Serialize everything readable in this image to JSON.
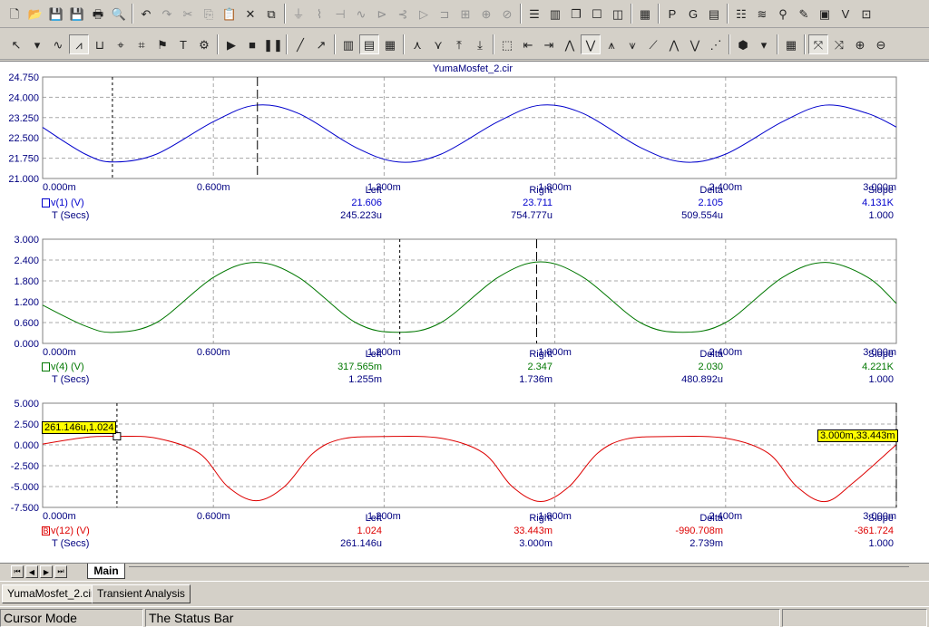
{
  "toolbar1": {
    "buttons": [
      {
        "name": "new-file-icon",
        "glyph": "🗋",
        "dim": false
      },
      {
        "name": "open-file-icon",
        "glyph": "📂",
        "dim": false
      },
      {
        "name": "save-icon",
        "glyph": "💾",
        "dim": false
      },
      {
        "name": "save-all-icon",
        "glyph": "💾",
        "dim": false
      },
      {
        "name": "print-icon",
        "glyph": "🖶",
        "dim": false
      },
      {
        "name": "print-preview-icon",
        "glyph": "🔍",
        "dim": false
      },
      {
        "name": "undo-icon",
        "glyph": "↶",
        "dim": false
      },
      {
        "name": "redo-icon",
        "glyph": "↷",
        "dim": true
      },
      {
        "name": "cut-icon",
        "glyph": "✂",
        "dim": true
      },
      {
        "name": "copy-icon",
        "glyph": "⎘",
        "dim": true
      },
      {
        "name": "paste-icon",
        "glyph": "📋",
        "dim": false
      },
      {
        "name": "delete-icon",
        "glyph": "✕",
        "dim": false
      },
      {
        "name": "copy-special-icon",
        "glyph": "⧉",
        "dim": false
      },
      {
        "name": "ground-icon",
        "glyph": "⏚",
        "dim": true
      },
      {
        "name": "resistor-icon",
        "glyph": "⌇",
        "dim": true
      },
      {
        "name": "capacitor-icon",
        "glyph": "⊣",
        "dim": true
      },
      {
        "name": "inductor-icon",
        "glyph": "∿",
        "dim": true
      },
      {
        "name": "diode-icon",
        "glyph": "⊳",
        "dim": true
      },
      {
        "name": "transistor-icon",
        "glyph": "⊰",
        "dim": true
      },
      {
        "name": "opamp-icon",
        "glyph": "▷",
        "dim": true
      },
      {
        "name": "switch-icon",
        "glyph": "⊐",
        "dim": true
      },
      {
        "name": "meter-icon",
        "glyph": "⊞",
        "dim": true
      },
      {
        "name": "voltage-source-icon",
        "glyph": "⊕",
        "dim": true
      },
      {
        "name": "current-source-icon",
        "glyph": "⊘",
        "dim": true
      },
      {
        "name": "tile-horizontal-icon",
        "glyph": "☰",
        "dim": false
      },
      {
        "name": "tile-vertical-icon",
        "glyph": "▥",
        "dim": false
      },
      {
        "name": "cascade-icon",
        "glyph": "❐",
        "dim": false
      },
      {
        "name": "maximize-window-icon",
        "glyph": "☐",
        "dim": false
      },
      {
        "name": "split-window-icon",
        "glyph": "◫",
        "dim": false
      },
      {
        "name": "calculator-icon",
        "glyph": "▦",
        "dim": false
      },
      {
        "name": "text-p-icon",
        "glyph": "P",
        "dim": false
      },
      {
        "name": "text-g-icon",
        "glyph": "G",
        "dim": false
      },
      {
        "name": "properties-icon",
        "glyph": "▤",
        "dim": false
      },
      {
        "name": "list-icon",
        "glyph": "☷",
        "dim": false
      },
      {
        "name": "waveform-icon",
        "glyph": "≋",
        "dim": false
      },
      {
        "name": "probe-icon",
        "glyph": "⚲",
        "dim": false
      },
      {
        "name": "marker-pen-icon",
        "glyph": "✎",
        "dim": false
      },
      {
        "name": "scope-icon",
        "glyph": "▣",
        "dim": false
      },
      {
        "name": "vd-icon",
        "glyph": "V",
        "dim": false
      },
      {
        "name": "zoom-window-icon",
        "glyph": "⊡",
        "dim": false
      }
    ]
  },
  "toolbar2": {
    "buttons": [
      {
        "name": "select-mode-icon",
        "glyph": "↖",
        "pressed": false
      },
      {
        "name": "select-dropdown-icon",
        "glyph": "▾",
        "pressed": false
      },
      {
        "name": "add-curve-icon",
        "glyph": "∿",
        "pressed": false
      },
      {
        "name": "cursor-mode-icon",
        "glyph": "⩘",
        "pressed": true
      },
      {
        "name": "scale-mode-icon",
        "glyph": "⊔",
        "pressed": false
      },
      {
        "name": "point-tag-icon",
        "glyph": "⌖",
        "pressed": false
      },
      {
        "name": "graph-tag-icon",
        "glyph": "⌗",
        "pressed": false
      },
      {
        "name": "tag-icon",
        "glyph": "⚑",
        "pressed": false
      },
      {
        "name": "text-tool-icon",
        "glyph": "T",
        "pressed": false
      },
      {
        "name": "properties-dialog-icon",
        "glyph": "⚙",
        "pressed": false
      },
      {
        "name": "run-icon",
        "glyph": "▶",
        "pressed": false
      },
      {
        "name": "stop-icon",
        "glyph": "■",
        "pressed": false
      },
      {
        "name": "pause-icon",
        "glyph": "❚❚",
        "pressed": false
      },
      {
        "name": "draw-line-icon",
        "glyph": "╱",
        "pressed": false
      },
      {
        "name": "draw-arrow-icon",
        "glyph": "↗",
        "pressed": false
      },
      {
        "name": "grid-icon",
        "glyph": "▥",
        "pressed": false
      },
      {
        "name": "minor-grid-icon",
        "glyph": "▤",
        "pressed": true
      },
      {
        "name": "data-points-icon",
        "glyph": "▦",
        "pressed": false
      },
      {
        "name": "peak-icon",
        "glyph": "⋏",
        "pressed": false
      },
      {
        "name": "valley-icon",
        "glyph": "⋎",
        "pressed": false
      },
      {
        "name": "high-icon",
        "glyph": "⤒",
        "pressed": false
      },
      {
        "name": "low-icon",
        "glyph": "⤓",
        "pressed": false
      },
      {
        "name": "graph-view-icon",
        "glyph": "⬚",
        "pressed": false
      },
      {
        "name": "cursor-left-icon",
        "glyph": "⇤",
        "pressed": false
      },
      {
        "name": "cursor-right-icon",
        "glyph": "⇥",
        "pressed": false
      },
      {
        "name": "next-peak-icon",
        "glyph": "⋀",
        "pressed": false
      },
      {
        "name": "next-valley-icon",
        "glyph": "⋁",
        "pressed": true
      },
      {
        "name": "next-high-icon",
        "glyph": "⩚",
        "pressed": false
      },
      {
        "name": "next-low-icon",
        "glyph": "⩛",
        "pressed": false
      },
      {
        "name": "inflection-icon",
        "glyph": "⟋",
        "pressed": false
      },
      {
        "name": "global-high-icon",
        "glyph": "⋀",
        "pressed": false
      },
      {
        "name": "global-low-icon",
        "glyph": "⋁",
        "pressed": false
      },
      {
        "name": "slope-icon",
        "glyph": "⋰",
        "pressed": false
      },
      {
        "name": "package-icon",
        "glyph": "⬢",
        "pressed": false
      },
      {
        "name": "package-dropdown-icon",
        "glyph": "▾",
        "pressed": false
      },
      {
        "name": "table-icon",
        "glyph": "▦",
        "pressed": false
      },
      {
        "name": "cursor-x-icon",
        "glyph": "⤧",
        "pressed": true
      },
      {
        "name": "cursor-y-icon",
        "glyph": "⤨",
        "pressed": false
      },
      {
        "name": "zoom-in-icon",
        "glyph": "⊕",
        "pressed": false
      },
      {
        "name": "zoom-out-icon",
        "glyph": "⊖",
        "pressed": false
      }
    ]
  },
  "plot": {
    "title": "YumaMosfet_2.cir",
    "info_headers": {
      "left": "Left",
      "right": "Right",
      "delta": "Delta",
      "slope": "Slope"
    },
    "panels": [
      {
        "expression": "v(1) (V)",
        "time_label": "T (Secs)",
        "color": "#0000cc",
        "y_ticks": [
          "24.750",
          "24.000",
          "23.250",
          "22.500",
          "21.750",
          "21.000"
        ],
        "x_ticks": [
          "0.000m",
          "0.600m",
          "1.200m",
          "1.800m",
          "2.400m",
          "3.000m"
        ],
        "values": {
          "left": "21.606",
          "right": "23.711",
          "delta": "2.105",
          "slope": "4.131K"
        },
        "times": {
          "left": "245.223u",
          "right": "754.777u",
          "delta": "509.554u",
          "slope": "1.000"
        }
      },
      {
        "expression": "v(4) (V)",
        "time_label": "T (Secs)",
        "color": "#007700",
        "y_ticks": [
          "3.000",
          "2.400",
          "1.800",
          "1.200",
          "0.600",
          "0.000"
        ],
        "x_ticks": [
          "0.000m",
          "0.600m",
          "1.200m",
          "1.800m",
          "2.400m",
          "3.000m"
        ],
        "values": {
          "left": "317.565m",
          "right": "2.347",
          "delta": "2.030",
          "slope": "4.221K"
        },
        "times": {
          "left": "1.255m",
          "right": "1.736m",
          "delta": "480.892u",
          "slope": "1.000"
        }
      },
      {
        "expression": "v(12) (V)",
        "marker": "B",
        "time_label": "T (Secs)",
        "color": "#dd0000",
        "y_ticks": [
          "5.000",
          "2.500",
          "0.000",
          "-2.500",
          "-5.000",
          "-7.500"
        ],
        "x_ticks": [
          "0.000m",
          "0.600m",
          "1.200m",
          "1.800m",
          "2.400m",
          "3.000m"
        ],
        "values": {
          "left": "1.024",
          "right": "33.443m",
          "delta": "-990.708m",
          "slope": "-361.724"
        },
        "times": {
          "left": "261.146u",
          "right": "3.000m",
          "delta": "2.739m",
          "slope": "1.000"
        },
        "left_readout": "261.146u,1.024",
        "right_readout": "3.000m,33.443m"
      }
    ]
  },
  "chart_data": [
    {
      "type": "line",
      "title": "YumaMosfet_2.cir",
      "xlabel": "T (Secs)",
      "ylabel": "",
      "xlim": [
        0,
        0.003
      ],
      "ylim": [
        21.0,
        24.75
      ],
      "series": [
        {
          "name": "v(1) (V)",
          "x": [
            0,
            0.00015,
            0.00025,
            0.0004,
            0.0006,
            0.00075,
            0.0009,
            0.0011,
            0.00125,
            0.0014,
            0.0016,
            0.00175,
            0.0019,
            0.0021,
            0.00225,
            0.0024,
            0.0026,
            0.00275,
            0.0029,
            0.003
          ],
          "y": [
            22.89,
            21.9,
            21.61,
            21.9,
            23.1,
            23.71,
            23.4,
            22.15,
            21.61,
            21.9,
            23.1,
            23.71,
            23.4,
            22.15,
            21.61,
            21.9,
            23.1,
            23.71,
            23.4,
            22.9
          ]
        }
      ]
    },
    {
      "type": "line",
      "xlabel": "T (Secs)",
      "ylabel": "",
      "xlim": [
        0,
        0.003
      ],
      "ylim": [
        0,
        3.0
      ],
      "series": [
        {
          "name": "v(4) (V)",
          "x": [
            0,
            0.00015,
            0.00025,
            0.0004,
            0.0006,
            0.00075,
            0.0009,
            0.0011,
            0.00125,
            0.0014,
            0.0016,
            0.00175,
            0.0019,
            0.0021,
            0.00225,
            0.0024,
            0.0026,
            0.00275,
            0.0029,
            0.003
          ],
          "y": [
            1.1,
            0.5,
            0.32,
            0.6,
            1.9,
            2.33,
            1.9,
            0.6,
            0.32,
            0.6,
            1.9,
            2.347,
            1.9,
            0.6,
            0.32,
            0.6,
            1.9,
            2.33,
            1.9,
            1.15
          ]
        }
      ]
    },
    {
      "type": "line",
      "xlabel": "T (Secs)",
      "ylabel": "",
      "xlim": [
        0,
        0.003
      ],
      "ylim": [
        -7.5,
        5.0
      ],
      "series": [
        {
          "name": "v(12) (V)",
          "x": [
            0,
            0.00015,
            0.00026,
            0.0004,
            0.00055,
            0.00065,
            0.00075,
            0.00085,
            0.00095,
            0.00105,
            0.0012,
            0.0014,
            0.00155,
            0.00165,
            0.00175,
            0.00185,
            0.00195,
            0.00205,
            0.0022,
            0.0024,
            0.00255,
            0.00265,
            0.00275,
            0.00285,
            0.003
          ],
          "y": [
            0.1,
            0.9,
            1.024,
            0.8,
            -1.0,
            -5.0,
            -6.7,
            -5.0,
            -1.0,
            0.7,
            1.0,
            0.8,
            -1.0,
            -5.0,
            -6.8,
            -5.0,
            -1.0,
            0.7,
            1.0,
            0.8,
            -1.0,
            -5.0,
            -6.8,
            -4.5,
            0.03
          ]
        }
      ]
    }
  ],
  "tabs": {
    "plot_tab": "Main"
  },
  "doc_tabs": [
    "YumaMosfet_2.cir",
    "Transient Analysis"
  ],
  "status": {
    "mode": "Cursor Mode",
    "message": "The Status Bar"
  }
}
